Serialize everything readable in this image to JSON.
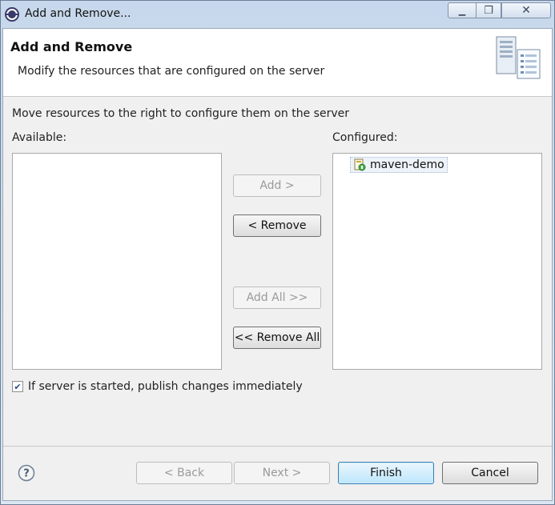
{
  "window": {
    "title": "Add and Remove...",
    "min_symbol": "▁",
    "max_symbol": "❐",
    "close_symbol": "✕"
  },
  "banner": {
    "title": "Add and Remove",
    "description": "Modify the resources that are configured on the server",
    "icon": "server-icon"
  },
  "body": {
    "instructions": "Move resources to the right to configure them on the server",
    "available_label": "Available:",
    "configured_label": "Configured:",
    "available_items": [],
    "configured_items": [
      {
        "label": "maven-demo",
        "icon": "project-icon"
      }
    ]
  },
  "buttons": {
    "add": "Add >",
    "remove": "< Remove",
    "add_all": "Add All >>",
    "remove_all": "<< Remove All"
  },
  "checkbox": {
    "label": "If server is started, publish changes immediately",
    "checked": true,
    "check_glyph": "✔"
  },
  "footer": {
    "help_icon": "help-icon",
    "back": "< Back",
    "next": "Next >",
    "finish": "Finish",
    "cancel": "Cancel"
  },
  "colors": {
    "accent": "#3c7fb1",
    "disabled_text": "#9a9a9a"
  }
}
